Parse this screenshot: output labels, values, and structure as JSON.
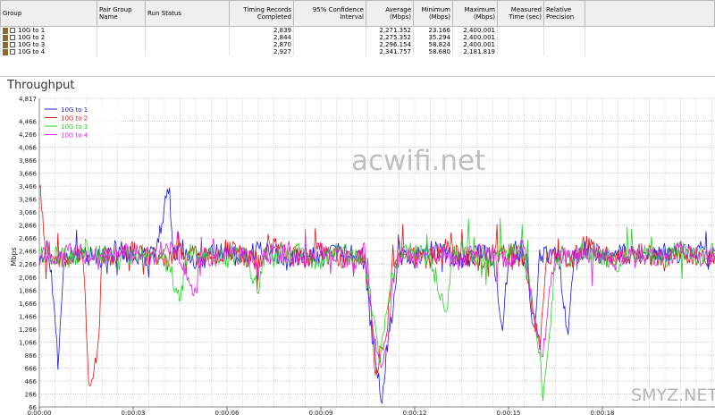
{
  "table": {
    "headers": [
      "Group",
      "Pair Group Name",
      "Run Status",
      "Timing Records Completed",
      "95% Confidence Interval",
      "Average (Mbps)",
      "Minimum (Mbps)",
      "Maximum (Mbps)",
      "Measured Time (sec)",
      "Relative Precision"
    ],
    "rows": [
      {
        "group": "10G to 1",
        "records": "2,839",
        "average": "2,271.352",
        "minimum": "23.166",
        "maximum": "2,400.001"
      },
      {
        "group": "10G to 2",
        "records": "2,844",
        "average": "2,275.352",
        "minimum": "35.294",
        "maximum": "2,400.001"
      },
      {
        "group": "10G to 3",
        "records": "2,870",
        "average": "2,296.154",
        "minimum": "58.824",
        "maximum": "2,400.001"
      },
      {
        "group": "10G to 4",
        "records": "2,927",
        "average": "2,341.757",
        "minimum": "58.680",
        "maximum": "2,181.819"
      }
    ]
  },
  "chart_data": {
    "type": "line",
    "title": "Throughput",
    "xlabel": "",
    "ylabel": "Mbps",
    "ylim": [
      66,
      4817
    ],
    "xlim": [
      0,
      21.6
    ],
    "yticks": [
      "4,817",
      "4,466",
      "4,266",
      "4,066",
      "3,866",
      "3,666",
      "3,466",
      "3,266",
      "3,066",
      "2,866",
      "2,666",
      "2,466",
      "2,266",
      "2,066",
      "1,866",
      "1,666",
      "1,466",
      "1,266",
      "1,066",
      "866",
      "666",
      "466",
      "266",
      "66"
    ],
    "ytick_values": [
      4817,
      4466,
      4266,
      4066,
      3866,
      3666,
      3466,
      3266,
      3066,
      2866,
      2666,
      2466,
      2266,
      2066,
      1866,
      1666,
      1466,
      1266,
      1066,
      866,
      666,
      466,
      266,
      66
    ],
    "xticks": [
      "0:00:00",
      "0:00:03",
      "0:00:06",
      "0:00:09",
      "0:00:12",
      "0:00:15",
      "0:00:18"
    ],
    "xtick_values": [
      0,
      3,
      6,
      9,
      12,
      15,
      18
    ],
    "grid": true,
    "legend_position": "top-left",
    "series": [
      {
        "name": "10G to 1",
        "color": "#1c1cd6",
        "points": [
          [
            0,
            2400
          ],
          [
            0.3,
            2500
          ],
          [
            0.5,
            1500
          ],
          [
            0.6,
            650
          ],
          [
            0.8,
            2300
          ],
          [
            1.2,
            2450
          ],
          [
            1.6,
            2400
          ],
          [
            2.0,
            2350
          ],
          [
            2.5,
            2500
          ],
          [
            3.0,
            2400
          ],
          [
            3.5,
            2350
          ],
          [
            3.8,
            2600
          ],
          [
            4.1,
            3350
          ],
          [
            4.3,
            2400
          ],
          [
            4.6,
            2500
          ],
          [
            5.0,
            2300
          ],
          [
            5.5,
            2400
          ],
          [
            6.0,
            2450
          ],
          [
            6.5,
            2350
          ],
          [
            7.0,
            2500
          ],
          [
            7.5,
            2400
          ],
          [
            8.0,
            2300
          ],
          [
            8.5,
            2450
          ],
          [
            9.0,
            2350
          ],
          [
            9.5,
            2500
          ],
          [
            10.0,
            2400
          ],
          [
            10.4,
            2300
          ],
          [
            10.6,
            1300
          ],
          [
            10.8,
            700
          ],
          [
            10.95,
            200
          ],
          [
            11.1,
            900
          ],
          [
            11.3,
            1600
          ],
          [
            11.5,
            2400
          ],
          [
            12.0,
            2350
          ],
          [
            12.5,
            2500
          ],
          [
            13.0,
            2400
          ],
          [
            13.5,
            2300
          ],
          [
            14.0,
            2450
          ],
          [
            14.5,
            2350
          ],
          [
            14.8,
            1300
          ],
          [
            15.0,
            2400
          ],
          [
            15.3,
            2500
          ],
          [
            15.6,
            2300
          ],
          [
            15.8,
            1100
          ],
          [
            16.0,
            2400
          ],
          [
            16.3,
            2450
          ],
          [
            16.6,
            2350
          ],
          [
            16.9,
            1200
          ],
          [
            17.1,
            2400
          ],
          [
            17.5,
            2500
          ],
          [
            18.0,
            2350
          ],
          [
            18.5,
            2450
          ],
          [
            19.0,
            2400
          ],
          [
            19.5,
            2300
          ],
          [
            20.0,
            2450
          ],
          [
            20.5,
            2400
          ],
          [
            21.0,
            2500
          ],
          [
            21.6,
            2400
          ]
        ]
      },
      {
        "name": "10G to 2",
        "color": "#e01818",
        "points": [
          [
            0,
            3600
          ],
          [
            0.2,
            2500
          ],
          [
            0.5,
            2400
          ],
          [
            0.8,
            2300
          ],
          [
            1.1,
            2450
          ],
          [
            1.4,
            2400
          ],
          [
            1.6,
            280
          ],
          [
            1.75,
            700
          ],
          [
            1.9,
            1100
          ],
          [
            2.0,
            2400
          ],
          [
            2.5,
            2350
          ],
          [
            3.0,
            2500
          ],
          [
            3.5,
            2400
          ],
          [
            4.0,
            2300
          ],
          [
            4.5,
            2450
          ],
          [
            5.0,
            2400
          ],
          [
            5.5,
            2350
          ],
          [
            6.0,
            2500
          ],
          [
            6.5,
            2400
          ],
          [
            7.0,
            2300
          ],
          [
            7.5,
            2600
          ],
          [
            8.0,
            2400
          ],
          [
            8.5,
            2350
          ],
          [
            9.0,
            2450
          ],
          [
            9.5,
            2400
          ],
          [
            10.0,
            2300
          ],
          [
            10.4,
            2400
          ],
          [
            10.6,
            1500
          ],
          [
            10.75,
            550
          ],
          [
            10.9,
            900
          ],
          [
            11.1,
            1200
          ],
          [
            11.3,
            2300
          ],
          [
            11.5,
            2450
          ],
          [
            12.0,
            2400
          ],
          [
            12.5,
            2350
          ],
          [
            13.0,
            2500
          ],
          [
            13.5,
            2400
          ],
          [
            14.0,
            2300
          ],
          [
            14.5,
            2450
          ],
          [
            15.0,
            2400
          ],
          [
            15.5,
            2350
          ],
          [
            15.8,
            1500
          ],
          [
            16.0,
            900
          ],
          [
            16.2,
            2400
          ],
          [
            16.5,
            2450
          ],
          [
            17.0,
            2350
          ],
          [
            17.5,
            2600
          ],
          [
            18.0,
            2400
          ],
          [
            18.5,
            2350
          ],
          [
            19.0,
            2450
          ],
          [
            19.5,
            2400
          ],
          [
            20.0,
            2300
          ],
          [
            20.5,
            2450
          ],
          [
            21.0,
            2400
          ],
          [
            21.6,
            2350
          ]
        ]
      },
      {
        "name": "10G to 3",
        "color": "#22d622",
        "points": [
          [
            0,
            2450
          ],
          [
            0.5,
            2400
          ],
          [
            1.0,
            2350
          ],
          [
            1.5,
            2500
          ],
          [
            2.0,
            2400
          ],
          [
            2.5,
            2300
          ],
          [
            3.0,
            2450
          ],
          [
            3.5,
            2400
          ],
          [
            4.0,
            2350
          ],
          [
            4.5,
            1700
          ],
          [
            4.7,
            2400
          ],
          [
            5.0,
            2500
          ],
          [
            5.5,
            2400
          ],
          [
            6.0,
            2300
          ],
          [
            6.5,
            2450
          ],
          [
            7.0,
            1900
          ],
          [
            7.2,
            2400
          ],
          [
            7.5,
            2350
          ],
          [
            8.0,
            2500
          ],
          [
            8.5,
            2400
          ],
          [
            9.0,
            2300
          ],
          [
            9.5,
            2450
          ],
          [
            10.0,
            2400
          ],
          [
            10.4,
            2350
          ],
          [
            10.7,
            1400
          ],
          [
            10.85,
            800
          ],
          [
            11.0,
            1100
          ],
          [
            11.2,
            1900
          ],
          [
            11.5,
            2400
          ],
          [
            12.0,
            2450
          ],
          [
            12.5,
            2350
          ],
          [
            13.0,
            1500
          ],
          [
            13.2,
            2400
          ],
          [
            13.5,
            2500
          ],
          [
            14.0,
            2400
          ],
          [
            14.5,
            2350
          ],
          [
            15.0,
            2450
          ],
          [
            15.5,
            2400
          ],
          [
            15.9,
            1300
          ],
          [
            16.1,
            260
          ],
          [
            16.3,
            1100
          ],
          [
            16.5,
            2400
          ],
          [
            17.0,
            2350
          ],
          [
            17.5,
            2500
          ],
          [
            18.0,
            2400
          ],
          [
            18.5,
            2300
          ],
          [
            19.0,
            2450
          ],
          [
            19.5,
            2400
          ],
          [
            20.0,
            2350
          ],
          [
            20.5,
            2500
          ],
          [
            21.0,
            2400
          ],
          [
            21.6,
            2450
          ]
        ]
      },
      {
        "name": "10G to 4",
        "color": "#e020e0",
        "points": [
          [
            0,
            2400
          ],
          [
            0.5,
            2350
          ],
          [
            1.0,
            2450
          ],
          [
            1.5,
            2400
          ],
          [
            2.0,
            2300
          ],
          [
            2.5,
            2450
          ],
          [
            3.0,
            2400
          ],
          [
            3.5,
            2350
          ],
          [
            4.0,
            2500
          ],
          [
            4.5,
            2400
          ],
          [
            5.0,
            1800
          ],
          [
            5.2,
            2400
          ],
          [
            5.5,
            2350
          ],
          [
            6.0,
            2450
          ],
          [
            6.5,
            2400
          ],
          [
            7.0,
            2300
          ],
          [
            7.5,
            2450
          ],
          [
            8.0,
            2400
          ],
          [
            8.5,
            2350
          ],
          [
            9.0,
            2500
          ],
          [
            9.5,
            2400
          ],
          [
            10.0,
            2300
          ],
          [
            10.4,
            2450
          ],
          [
            10.7,
            1200
          ],
          [
            10.9,
            700
          ],
          [
            11.1,
            1000
          ],
          [
            11.3,
            2000
          ],
          [
            11.5,
            2400
          ],
          [
            12.0,
            2350
          ],
          [
            12.5,
            2450
          ],
          [
            13.0,
            2400
          ],
          [
            13.5,
            2300
          ],
          [
            14.0,
            2450
          ],
          [
            14.5,
            2400
          ],
          [
            15.0,
            2350
          ],
          [
            15.5,
            2500
          ],
          [
            15.9,
            1200
          ],
          [
            16.1,
            900
          ],
          [
            16.3,
            1800
          ],
          [
            16.5,
            2400
          ],
          [
            17.0,
            2350
          ],
          [
            17.5,
            2450
          ],
          [
            18.0,
            2400
          ],
          [
            18.5,
            2300
          ],
          [
            19.0,
            2450
          ],
          [
            19.5,
            2400
          ],
          [
            20.0,
            2350
          ],
          [
            20.5,
            2500
          ],
          [
            21.0,
            2400
          ],
          [
            21.6,
            2350
          ]
        ]
      }
    ]
  },
  "watermarks": {
    "center": "acwifi.net",
    "corner": "SMYZ.NET"
  }
}
